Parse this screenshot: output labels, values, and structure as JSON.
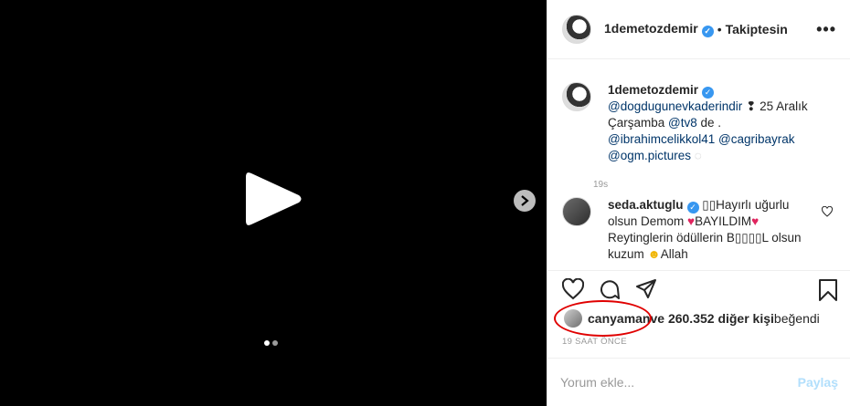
{
  "media": {
    "dots": 2,
    "active_index": 0
  },
  "header": {
    "username": "1demetozdemir",
    "separator": "•",
    "follow_status": "Takiptesin",
    "more": "•••"
  },
  "caption": {
    "username": "1demetozdemir",
    "link1": "@dogdugunevkaderindir",
    "text1": " ❢ 25 Aralık Çarşamba ",
    "link2": "@tv8",
    "text2": " de . ",
    "link3": "@ibrahimcelikkol41",
    "link4": "@cagribayrak",
    "link5": "@ogm.pictures",
    "emoji": " ◌",
    "time": "19s"
  },
  "comment": {
    "username": "seda.aktuglu",
    "text1": " ▯▯Hayırlı uğurlu olsun Demom ",
    "text2": "BAYILDIM",
    "text3": " Reytinglerin ödüllerin B▯▯▯▯L olsun kuzum ",
    "text4": "Allah"
  },
  "likes": {
    "user": "canyaman",
    "rest": " ve 260.352 diğer kişi",
    "suffix": " beğendi"
  },
  "ago": "19 SAAT ÖNCE",
  "add_comment": {
    "placeholder": "Yorum ekle...",
    "post": "Paylaş"
  },
  "colors": {
    "verified": "#3897f0",
    "link": "#003569",
    "annotation": "#e00000",
    "heart": "#e0245e"
  }
}
